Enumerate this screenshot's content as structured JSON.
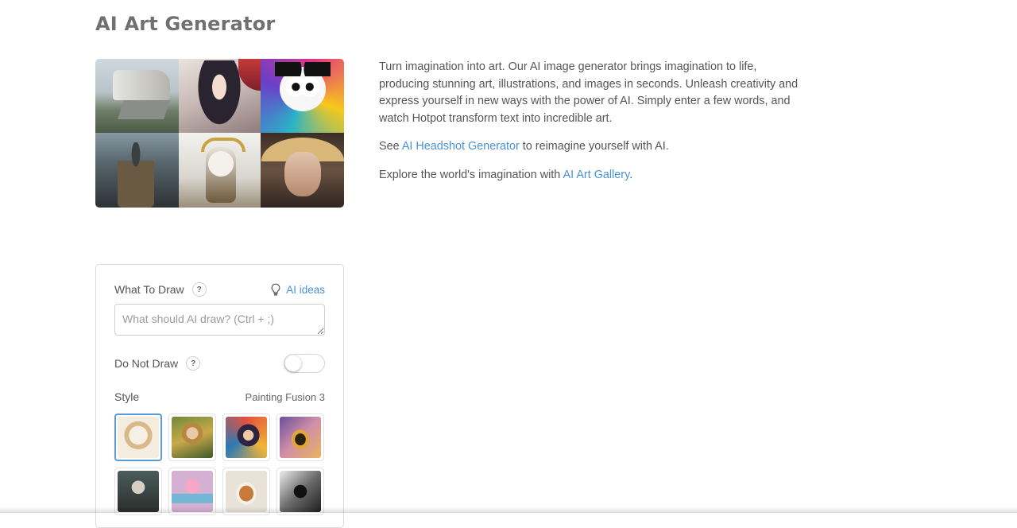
{
  "page": {
    "title": "AI Art Generator"
  },
  "intro": {
    "paragraph1": "Turn imagination into art. Our AI image generator brings imagination to life, producing stunning art, illustrations, and images in seconds. Unleash creativity and express yourself in new ways with the power of AI. Simply enter a few words, and watch Hotpot transform text into incredible art.",
    "see_prefix": "See ",
    "headshot_link": "AI Headshot Generator",
    "see_suffix": " to reimagine yourself with AI.",
    "explore_prefix": "Explore the world's imagination with ",
    "gallery_link": "AI Art Gallery",
    "explore_suffix": "."
  },
  "form": {
    "what_to_draw_label": "What To Draw",
    "help_glyph": "?",
    "ai_ideas_label": "AI ideas",
    "prompt_placeholder": "What should AI draw? (Ctrl + ;)",
    "do_not_draw_label": "Do Not Draw",
    "do_not_draw_enabled": false,
    "style_label": "Style",
    "style_value": "Painting Fusion 3"
  },
  "colors": {
    "link": "#4a90d9",
    "selected_border": "#5b9bd5"
  }
}
